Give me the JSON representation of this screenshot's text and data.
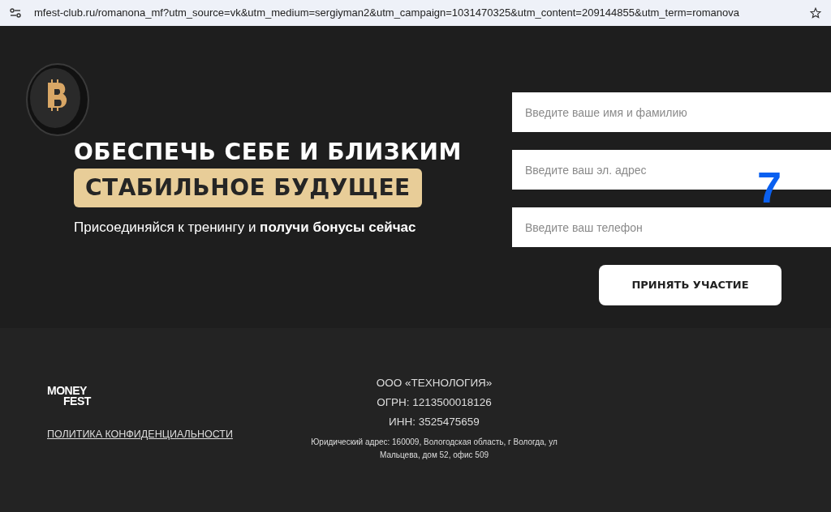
{
  "browser": {
    "address": "mfest-club.ru/romanona_mf?utm_source=vk&utm_medium=sergiyman2&utm_campaign=1031470325&utm_content=209144855&utm_term=romanova"
  },
  "hero": {
    "headline": "ОБЕСПЕЧЬ СЕБЕ И БЛИЗКИМ",
    "highlight": "СТАБИЛЬНОЕ БУДУЩЕЕ",
    "subtitle": "Присоединяйся к тренингу и **получи бонусы сейчас**"
  },
  "form": {
    "fields": [
      {
        "placeholder": "Введите ваше имя и фамилию"
      },
      {
        "placeholder": "Введите ваш эл. адрес"
      },
      {
        "placeholder": "Введите ваш телефон"
      }
    ],
    "submit": "ПРИНЯТЬ УЧАСТИЕ",
    "overlay_label": "7"
  },
  "footer": {
    "logo": [
      "MONEY",
      "FEST"
    ],
    "privacy_link": "ПОЛИТИКА КОНФИДЕНЦИАЛЬНОСТИ",
    "company": [
      "ООО «ТЕХНОЛОГИЯ»",
      "ОГРН: 1213500018126",
      "ИНН: 3525475659"
    ],
    "address": "Юридический адрес: 160009, Вологодская область, г Вологда, ул Мальцева, дом 52, офис 509"
  }
}
